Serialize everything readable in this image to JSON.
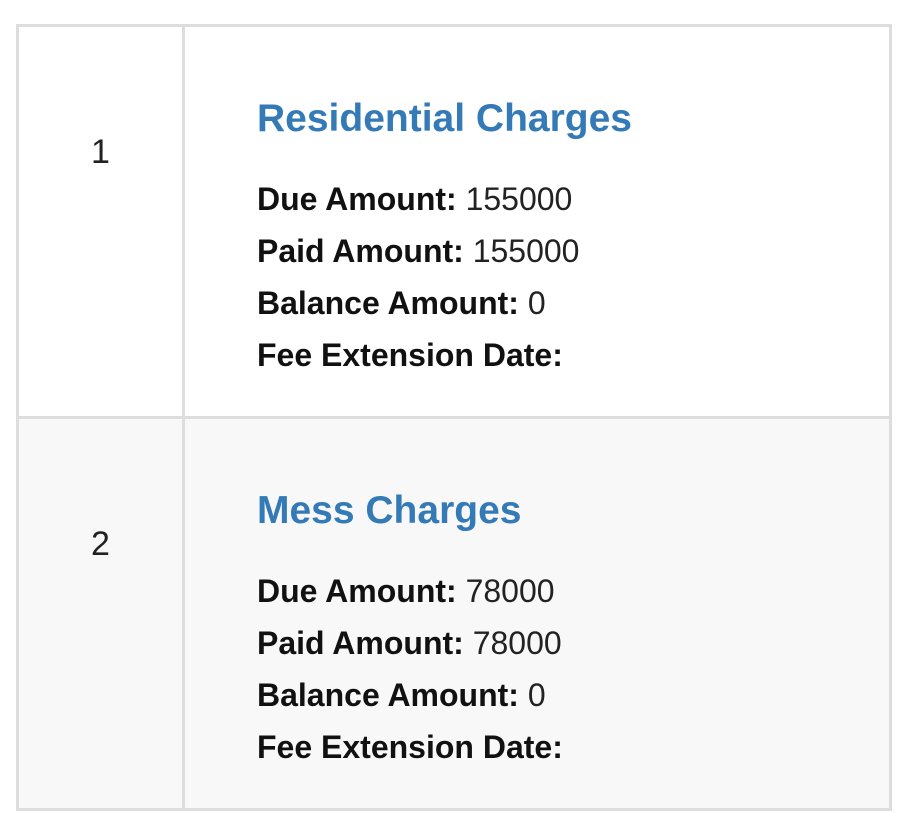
{
  "fees": [
    {
      "index": "1",
      "title": "Residential Charges",
      "due_label": "Due Amount:",
      "due_value": "155000",
      "paid_label": "Paid Amount:",
      "paid_value": "155000",
      "balance_label": "Balance Amount:",
      "balance_value": "0",
      "extension_label": "Fee Extension Date:",
      "extension_value": ""
    },
    {
      "index": "2",
      "title": "Mess Charges",
      "due_label": "Due Amount:",
      "due_value": "78000",
      "paid_label": "Paid Amount:",
      "paid_value": "78000",
      "balance_label": "Balance Amount:",
      "balance_value": "0",
      "extension_label": "Fee Extension Date:",
      "extension_value": ""
    }
  ]
}
